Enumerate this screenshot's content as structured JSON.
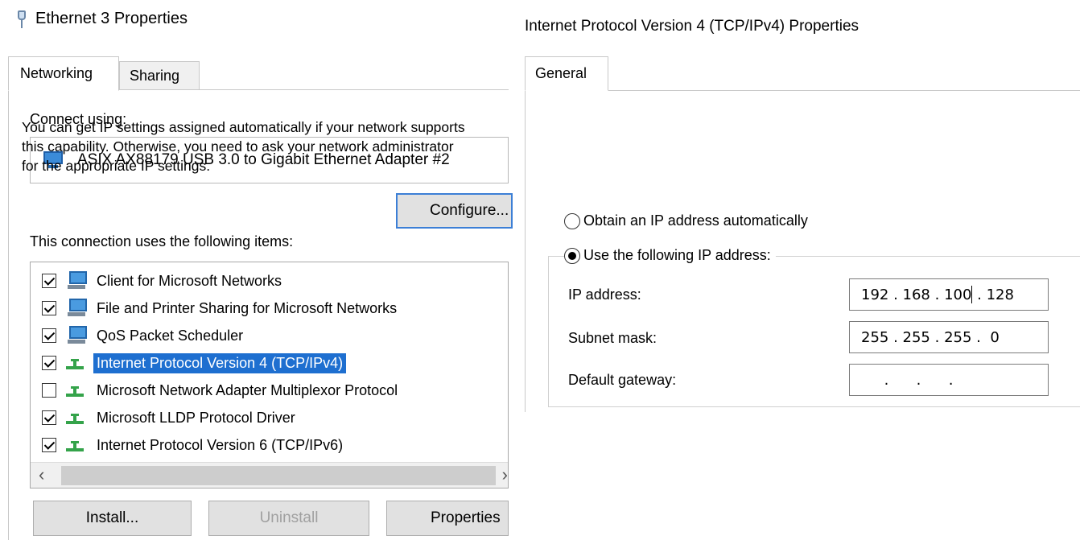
{
  "left": {
    "title": "Ethernet 3 Properties",
    "tabs": [
      {
        "label": "Networking",
        "active": true
      },
      {
        "label": "Sharing",
        "active": false
      }
    ],
    "connect_using_label": "Connect using:",
    "adapter_name": "ASIX AX88179 USB 3.0 to Gigabit Ethernet Adapter #2",
    "configure_label": "Configure...",
    "items_label": "This connection uses the following items:",
    "items": [
      {
        "label": "Client for Microsoft Networks",
        "checked": true,
        "icon": "computer-icon",
        "selected": false
      },
      {
        "label": "File and Printer Sharing for Microsoft Networks",
        "checked": true,
        "icon": "computer-icon",
        "selected": false
      },
      {
        "label": "QoS Packet Scheduler",
        "checked": true,
        "icon": "computer-icon",
        "selected": false
      },
      {
        "label": "Internet Protocol Version 4 (TCP/IPv4)",
        "checked": true,
        "icon": "protocol-icon",
        "selected": true
      },
      {
        "label": "Microsoft Network Adapter Multiplexor Protocol",
        "checked": false,
        "icon": "protocol-icon",
        "selected": false
      },
      {
        "label": "Microsoft LLDP Protocol Driver",
        "checked": true,
        "icon": "protocol-icon",
        "selected": false
      },
      {
        "label": "Internet Protocol Version 6 (TCP/IPv6)",
        "checked": true,
        "icon": "protocol-icon",
        "selected": false
      }
    ],
    "buttons": {
      "install": "Install...",
      "uninstall": "Uninstall",
      "properties": "Properties"
    }
  },
  "right": {
    "title": "Internet Protocol Version 4 (TCP/IPv4) Properties",
    "tab_general": "General",
    "description": [
      "You can get IP settings assigned automatically if your network supports",
      "this capability. Otherwise, you need to ask your network administrator",
      "for the appropriate IP settings."
    ],
    "radio_auto": "Obtain an IP address automatically",
    "radio_manual": "Use the following IP address:",
    "selected_radio": "manual",
    "fields": {
      "ip_label": "IP address:",
      "ip_octets": [
        "192",
        "168",
        "100",
        "128"
      ],
      "subnet_label": "Subnet mask:",
      "subnet_octets": [
        "255",
        "255",
        "255",
        "0"
      ],
      "gateway_label": "Default gateway:",
      "gateway_octets": [
        "",
        "",
        "",
        ""
      ]
    }
  },
  "colors": {
    "selection": "#1e6fd0",
    "focus_border": "#3c7fd6",
    "button_face": "#e1e1e1",
    "disabled_text": "#a0a0a0"
  }
}
